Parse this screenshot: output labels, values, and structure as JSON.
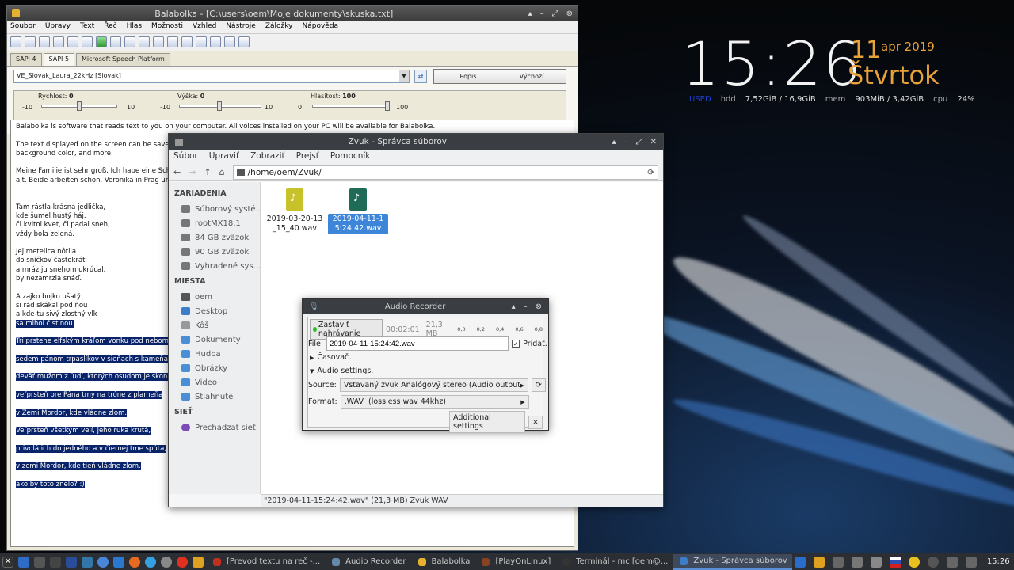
{
  "desktop": {
    "clock_time": "15:26",
    "clock_day": "11",
    "clock_month": "apr 2019",
    "clock_weekday": "Štvrtok",
    "used_label": "USED",
    "hdd_label": "hdd",
    "hdd_value": "7,52GiB / 16,9GiB",
    "mem_label": "mem",
    "mem_value": "903MiB / 3,42GiB",
    "cpu_label": "cpu",
    "cpu_value": "24%"
  },
  "balabolka": {
    "title": "Balabolka - [C:\\users\\oem\\Moje dokumenty\\skuska.txt]",
    "menu": [
      "Soubor",
      "Úpravy",
      "Text",
      "Řeč",
      "Hlas",
      "Možnosti",
      "Vzhled",
      "Nástroje",
      "Záložky",
      "Nápověda"
    ],
    "tabs": [
      "SAPI 4",
      "SAPI 5",
      "Microsoft Speech Platform"
    ],
    "voice": "VE_Slovak_Laura_22kHz [Slovak]",
    "btn_describe": "Popis",
    "btn_default": "Výchozí",
    "rate_label": "Rychlost:",
    "rate_value": "0",
    "pitch_label": "Výška:",
    "pitch_value": "0",
    "volume_label": "Hlasitost:",
    "volume_value": "100",
    "rate_min": "-10",
    "rate_max": "10",
    "pitch_min": "-10",
    "pitch_max": "10",
    "volume_min": "0",
    "volume_max": "100",
    "text_lines": [
      "Balabolka is software that reads text to you on your computer. All voices installed on your PC will be available for Balabolka.",
      "",
      "The text displayed on the screen can be saved in",
      "background color, and more.",
      "",
      "Meine Familie ist sehr groß. Ich habe eine Schwe",
      "alt. Beide arbeiten schon. Veronika in Prag und V",
      "",
      "",
      "Tam rástla krásna jedlička,",
      "kde šumel hustý háj,",
      "či kvitol kvet, či padal sneh,",
      "vždy bola zelená.",
      "",
      "Jej metelica nôtila",
      "do sníčkov častokrát",
      "a mráz ju snehom ukrúcal,",
      "by nezamrzla snáď.",
      "",
      "A zajko bojko ušatý",
      "si rád skákal pod ňou",
      "a kde-tu sivý zlostný vlk"
    ],
    "highlight_lines": [
      "sa mihol čistinou.",
      "",
      "Tri prstene elfským kráľom vonku pod nebom,",
      "",
      "sedem pánom trpaslíkov v sieňach s kameňa,",
      "",
      "deväť mužom z ľudí, ktorých osudom je skon,",
      "",
      "veľprsteň pre Pána tmy na tróne z plameňa",
      "",
      "v Zemi Mordor, kde vládne zlom.",
      "",
      "Veľprsteň všetkým velí, jeho ruka krutá,",
      "",
      "privolá ich do jedného a v čiernej tme spúta,",
      "",
      "v zemi Mordor, kde tieň vládne zlom.",
      "",
      "ako by toto znelo? :)"
    ]
  },
  "filemanager": {
    "title": "Zvuk - Správca súborov",
    "menu": [
      "Súbor",
      "Upraviť",
      "Zobraziť",
      "Prejsť",
      "Pomocník"
    ],
    "path": "/home/oem/Zvuk/",
    "devices_header": "ZARIADENIA",
    "devices": [
      "Súborový systé...",
      "rootMX18.1",
      "84 GB zväzok",
      "90 GB zväzok",
      "Vyhradené sys..."
    ],
    "places_header": "MIESTA",
    "places": [
      "oem",
      "Desktop",
      "Kôš",
      "Dokumenty",
      "Hudba",
      "Obrázky",
      "Video",
      "Stiahnuté"
    ],
    "network_header": "SIEŤ",
    "network": [
      "Prechádzať sieť"
    ],
    "files": [
      "2019-03-20-13_15_40.wav",
      "2019-04-11-15:24:42.wav"
    ],
    "status": "\"2019-04-11-15:24:42.wav\" (21,3 MB) Zvuk WAV"
  },
  "recorder": {
    "title": "Audio Recorder",
    "stop_button": "Zastaviť nahrávanie",
    "elapsed": "00:02:01",
    "size": "21,3 MB",
    "levels": [
      "0,0",
      "0,2",
      "0,4",
      "0,6",
      "0,8"
    ],
    "file_label": "File:",
    "file_value": "2019-04-11-15:24:42.wav",
    "append_label": "Pridať.",
    "timer_label": "Časovač.",
    "audio_settings_label": "Audio settings.",
    "source_label": "Source:",
    "source_value": "Vstavaný zvuk Analógový stereo (Audio output)",
    "format_label": "Format:",
    "format_value": ".WAV  (lossless wav 44khz)",
    "additional_settings": "Additional settings",
    "close_x": "×"
  },
  "taskbar": {
    "tasks": [
      "[Prevod textu na reč -...",
      "Audio Recorder",
      "Balabolka",
      "[PlayOnLinux]",
      "Terminál - mc [oem@...",
      "Zvuk - Správca súborov"
    ],
    "time": "15:26"
  }
}
